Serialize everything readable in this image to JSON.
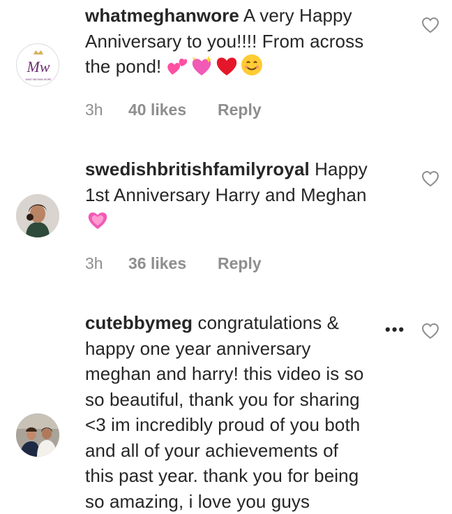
{
  "comments": [
    {
      "username": "whatmeghanwore",
      "text_lines": [
        " A very Happy",
        "Anniversary to you!!!! From across",
        "the pond! "
      ],
      "emojis": [
        "two-hearts-emoji",
        "sparkling-heart-emoji",
        "red-heart-emoji",
        "smiling-face-emoji"
      ],
      "time": "3h",
      "likes": "40 likes",
      "reply": "Reply",
      "avatar": {
        "monogram": "Mw",
        "caption": "WHAT MEGHAN WORE",
        "accent": "#6a2c6e"
      }
    },
    {
      "username": "swedishbritishfamilyroyal",
      "text_lines": [
        " Happy",
        "1st Anniversary Harry and Meghan"
      ],
      "emojis": [
        "sparkling-heart-emoji"
      ],
      "time": "3h",
      "likes": "36 likes",
      "reply": "Reply"
    },
    {
      "username": "cutebbymeg",
      "text_lines": [
        " congratulations &",
        "happy one year anniversary",
        "meghan and harry! this video is so",
        "so beautiful, thank you for sharing",
        "<3 im incredibly proud of you both",
        "and all of your achievements of",
        "this past year. thank you for being",
        "so amazing, i love you guys"
      ],
      "more": "•••"
    }
  ],
  "colors": {
    "text": "#262626",
    "meta": "#8e8e8e",
    "heart_outline": "#8e8e8e"
  }
}
